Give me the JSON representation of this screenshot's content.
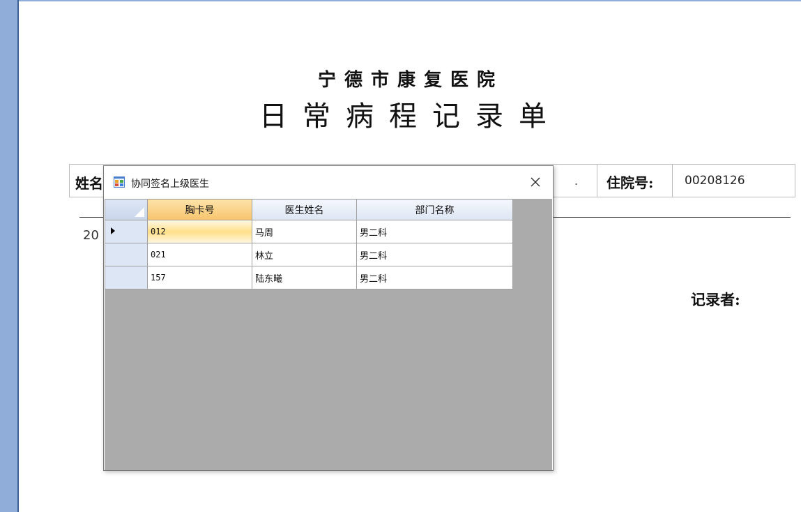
{
  "document": {
    "hospital_name": "宁德市康复医院",
    "form_title": "日常病程记录单",
    "name_label": "姓名",
    "name_field_trailing": ".",
    "admission_label": "住院号:",
    "admission_number": "00208126",
    "date_prefix": "20",
    "recorder_label": "记录者:"
  },
  "dialog": {
    "title": "协同签名上级医生",
    "columns": [
      "胸卡号",
      "医生姓名",
      "部门名称"
    ],
    "rows": [
      {
        "badge": "012",
        "name": "马周",
        "dept": "男二科"
      },
      {
        "badge": "021",
        "name": "林立",
        "dept": "男二科"
      },
      {
        "badge": "157",
        "name": "陆东曦",
        "dept": "男二科"
      }
    ],
    "selected_row": 0
  },
  "icons": {
    "app_icon": "form-window-icon",
    "close": "close-icon",
    "current_row": "current-row-arrow-icon"
  },
  "colors": {
    "accent_rail": "#8fadd8",
    "grid_background": "#ababab",
    "header_sorted": "#f7c46d",
    "header_normal": "#dde6f4"
  }
}
